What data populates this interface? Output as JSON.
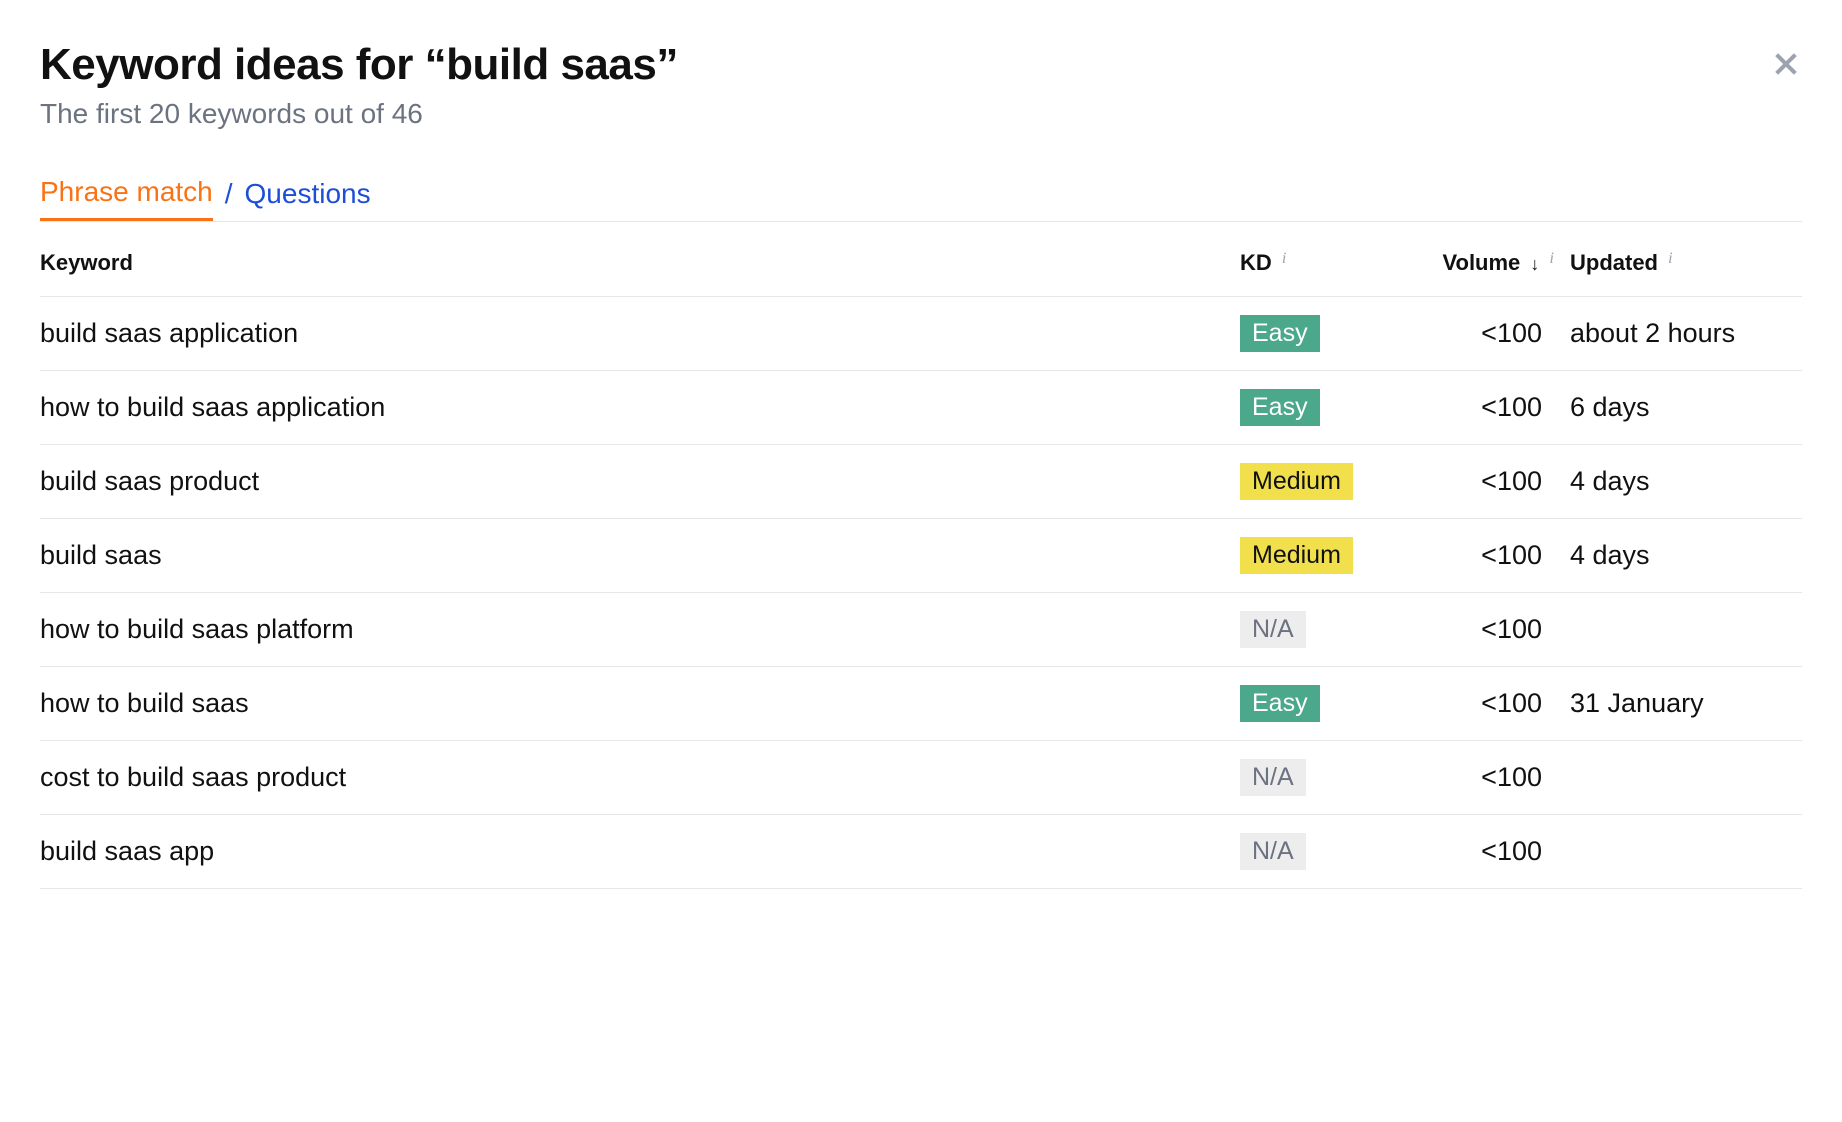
{
  "header": {
    "title": "Keyword ideas for “build saas”",
    "subtitle": "The first 20 keywords out of 46"
  },
  "tabs": {
    "phrase_match": "Phrase match",
    "separator": "/",
    "questions": "Questions"
  },
  "columns": {
    "keyword": "Keyword",
    "kd": "KD",
    "volume": "Volume",
    "updated": "Updated"
  },
  "badge_labels": {
    "easy": "Easy",
    "medium": "Medium",
    "na": "N/A"
  },
  "rows": [
    {
      "keyword": "build saas application",
      "kd": "easy",
      "volume": "<100",
      "updated": "about 2 hours"
    },
    {
      "keyword": "how to build saas application",
      "kd": "easy",
      "volume": "<100",
      "updated": "6 days"
    },
    {
      "keyword": "build saas product",
      "kd": "medium",
      "volume": "<100",
      "updated": "4 days"
    },
    {
      "keyword": "build saas",
      "kd": "medium",
      "volume": "<100",
      "updated": "4 days"
    },
    {
      "keyword": "how to build saas platform",
      "kd": "na",
      "volume": "<100",
      "updated": ""
    },
    {
      "keyword": "how to build saas",
      "kd": "easy",
      "volume": "<100",
      "updated": "31 January"
    },
    {
      "keyword": "cost to build saas product",
      "kd": "na",
      "volume": "<100",
      "updated": ""
    },
    {
      "keyword": "build saas app",
      "kd": "na",
      "volume": "<100",
      "updated": ""
    }
  ]
}
